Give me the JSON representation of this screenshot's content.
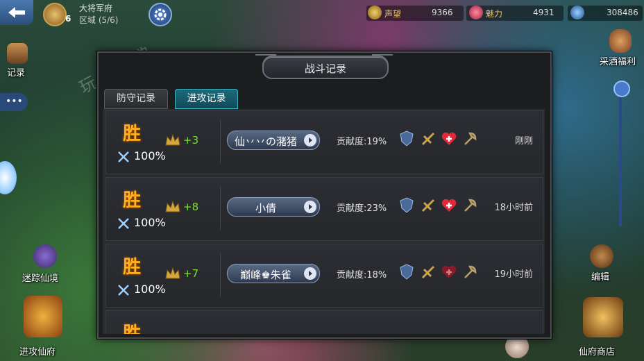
{
  "topbar": {
    "mansion_title": "大将军府",
    "level": "6",
    "region": "区域 (5/6)",
    "prestige_label": "声望",
    "prestige_value": "9366",
    "charm_label": "魅力",
    "charm_value": "4931",
    "currency_value": "308486"
  },
  "side": {
    "records": "记录",
    "maze": "迷踪仙境",
    "attack_mansion": "进攻仙府",
    "wine_welfare": "采酒福利",
    "edit": "编辑",
    "mansion_shop": "仙府商店"
  },
  "watermark": "玩咖宝典",
  "modal": {
    "title": "战斗记录",
    "tabs": [
      {
        "label": "防守记录",
        "active": false
      },
      {
        "label": "进攻记录",
        "active": true
      }
    ],
    "records": [
      {
        "result": "胜",
        "percent": "100%",
        "gain": "+3",
        "name": "仙丷丷の潴猪",
        "contribution": "贡献度:19%",
        "time": "刚刚"
      },
      {
        "result": "胜",
        "percent": "100%",
        "gain": "+8",
        "name": "小倩",
        "contribution": "贡献度:23%",
        "time": "18小时前"
      },
      {
        "result": "胜",
        "percent": "100%",
        "gain": "+7",
        "name": "巅峰♚朱雀",
        "contribution": "贡献度:18%",
        "time": "19小时前"
      },
      {
        "result": "胜",
        "percent": "",
        "gain": "",
        "name": "",
        "contribution": "",
        "time": ""
      }
    ]
  },
  "colors": {
    "win": "#ffb020",
    "gain": "#7fdc3a",
    "tab_active": "#1d6a7a"
  },
  "icons": [
    "back-arrow-icon",
    "settings-gear-icon",
    "shield-icon",
    "crown-icon",
    "heart-cross-icon",
    "sword-icon"
  ]
}
